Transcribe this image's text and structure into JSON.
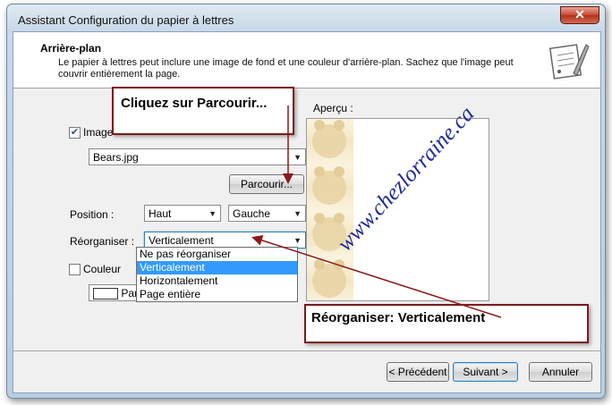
{
  "window": {
    "title": "Assistant Configuration du papier à lettres",
    "close_label": "✕"
  },
  "header": {
    "title": "Arrière-plan",
    "description": "Le papier à lettres peut inclure une image de fond et une couleur d'arrière-plan. Sachez que l'image peut couvrir entièrement la page."
  },
  "image_section": {
    "checkbox_label": "Image",
    "checked": true,
    "file_value": "Bears.jpg",
    "browse_label": "Parcourir..."
  },
  "position": {
    "label": "Position :",
    "vertical_value": "Haut",
    "horizontal_value": "Gauche"
  },
  "reorganize": {
    "label": "Réorganiser :",
    "value": "Verticalement",
    "options": [
      "Ne pas réorganiser",
      "Verticalement",
      "Horizontalement",
      "Page entière"
    ],
    "selected_index": 1
  },
  "color_section": {
    "checkbox_label": "Couleur",
    "checked": false,
    "color_value": "Par d"
  },
  "preview": {
    "label": "Aperçu :",
    "watermark": "www.chezlorraine.ca"
  },
  "callouts": {
    "browse_hint": "Cliquez sur Parcourir...",
    "reorganize_hint": "Réorganiser: Verticalement"
  },
  "footer": {
    "prev_label": "< Précédent",
    "next_label": "Suivant >",
    "cancel_label": "Annuler"
  },
  "colors": {
    "accent": "#3399ff",
    "callout_border": "#7a1b1b",
    "arrow": "#8b1a1a",
    "watermark": "#1f2a9a"
  }
}
